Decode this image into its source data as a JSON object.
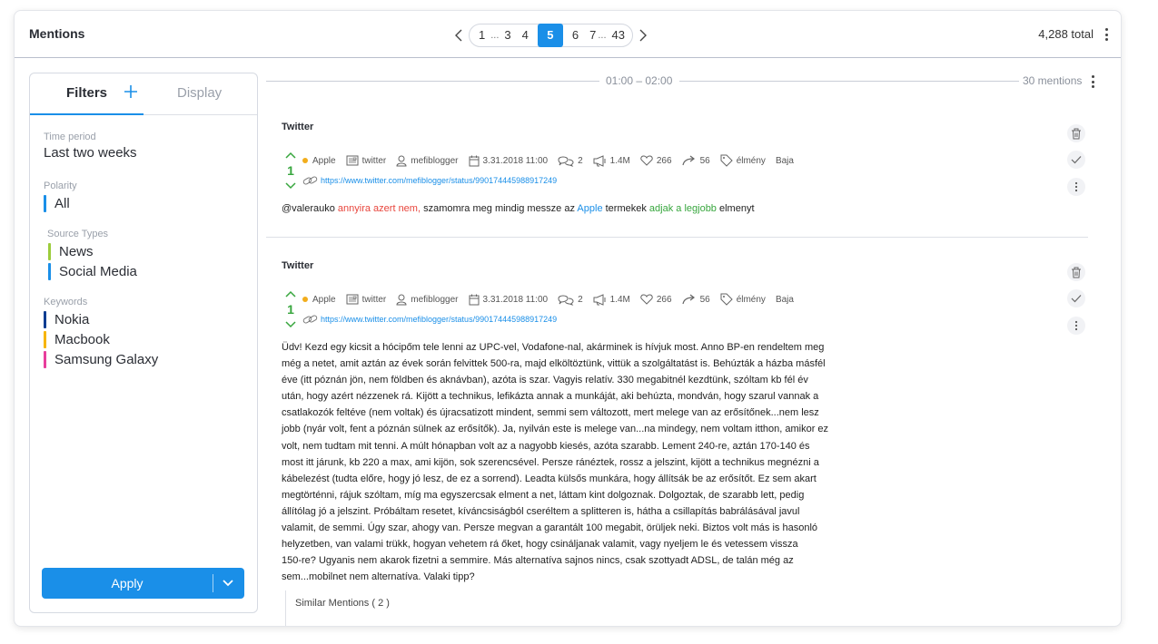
{
  "header": {
    "title": "Mentions",
    "total": "4,288 total"
  },
  "pager": {
    "pages": [
      "1",
      "3",
      "4",
      "5",
      "6",
      "7",
      "43"
    ],
    "ellipsis": "...",
    "active": "5"
  },
  "filters": {
    "tab_filters": "Filters",
    "tab_display": "Display",
    "time_period": {
      "label": "Time period",
      "value": "Last two weeks"
    },
    "polarity": {
      "label": "Polarity",
      "value": "All",
      "color": "#1a8fe8"
    },
    "source_types": {
      "label": "Source Types",
      "items": [
        {
          "label": "News",
          "color": "#9ccc3c"
        },
        {
          "label": "Social Media",
          "color": "#1a8fe8"
        }
      ]
    },
    "keywords": {
      "label": "Keywords",
      "items": [
        {
          "label": "Nokia",
          "color": "#0b3d91"
        },
        {
          "label": "Macbook",
          "color": "#f7b500"
        },
        {
          "label": "Samsung Galaxy",
          "color": "#e83e9c"
        }
      ]
    },
    "apply": "Apply"
  },
  "timeline": {
    "range": "01:00 – 02:00",
    "count": "30 mentions"
  },
  "mentions": [
    {
      "source": "Twitter",
      "votes": "1",
      "meta": {
        "keyword": "Apple",
        "platform": "twitter",
        "author": "mefiblogger",
        "date": "3.31.2018 11:00",
        "comments": "2",
        "reach": "1.4M",
        "likes": "266",
        "shares": "56",
        "tag": "élmény",
        "location": "Baja"
      },
      "url": "https://www.twitter.com/mefiblogger/status/990174445988917249",
      "text_parts": [
        "@valerauko ",
        "annyira azert nem,",
        " szamomra meg mindig messze az ",
        "Apple",
        " termekek ",
        "adjak a legjobb",
        " elmenyt"
      ]
    },
    {
      "source": "Twitter",
      "votes": "1",
      "meta": {
        "keyword": "Apple",
        "platform": "twitter",
        "author": "mefiblogger",
        "date": "3.31.2018 11:00",
        "comments": "2",
        "reach": "1.4M",
        "likes": "266",
        "shares": "56",
        "tag": "élmény",
        "location": "Baja"
      },
      "url": "https://www.twitter.com/mefiblogger/status/990174445988917249",
      "text_lines": [
        "Üdv! Kezd egy kicsit a hócipőm tele lenni az UPC-vel, Vodafone-nal, akárminek is hívjuk most. Anno BP-en rendeltem meg",
        "még a netet, amit aztán az évek során felvittek 500-ra, majd elköltöztünk, vittük a szolgáltatást is. Behúzták a házba másfél",
        "éve (itt póznán jön, nem földben és aknávban), azóta is szar. Vagyis relatív. 330 megabitnél kezdtünk, szóltam kb fél év",
        "után, hogy azért nézzenek rá. Kijött a technikus, lefikázta annak a munkáját, aki behúzta, mondván, hogy szarul vannak a",
        "csatlakozók feltéve (nem voltak) és újracsatizott mindent, semmi sem változott, mert melege van az erősítőnek...nem lesz",
        "jobb (nyár volt, fent a póznán sülnek az erősítők). Ja, nyilván este is melege van...na mindegy, nem voltam itthon, amikor ez",
        "volt, nem tudtam mit tenni. A múlt hónapban volt az a nagyobb kiesés, azóta szarabb. Lement 240-re, aztán 170-140 és",
        "most itt járunk, kb 220 a max, ami kijön, sok szerencsével. Persze ránéztek, rossz a jelszint, kijött a technikus megnézni a",
        "kábelezést (tudta előre, hogy jó lesz, de ez a sorrend). Leadta külsős munkára, hogy állítsák be az erősítőt. Ez sem akart",
        "megtörténni, rájuk szóltam, míg ma egyszercsak elment a net, láttam kint dolgoznak. Dolgoztak, de szarabb lett, pedig",
        "állítólag jó a jelszint. Próbáltam resetet, kíváncsiságból cseréltem a splitteren is, hátha a csillapítás babrálásával javul",
        "valamit, de semmi. Úgy szar, ahogy van. Persze megvan a garantált 100 megabit, örüljek neki. Biztos volt más is hasonló",
        "helyzetben, van valami trükk, hogyan vehetem rá őket, hogy csináljanak valamit, vagy nyeljem le és vetessem vissza",
        "150-re? Ugyanis nem akarok fizetni a semmire. Más alternatíva sajnos nincs, csak szottyadt ADSL, de talán még az",
        "sem...mobilnet nem alternatíva. Valaki tipp?"
      ],
      "similar": "Similar Mentions ( 2 )"
    }
  ]
}
